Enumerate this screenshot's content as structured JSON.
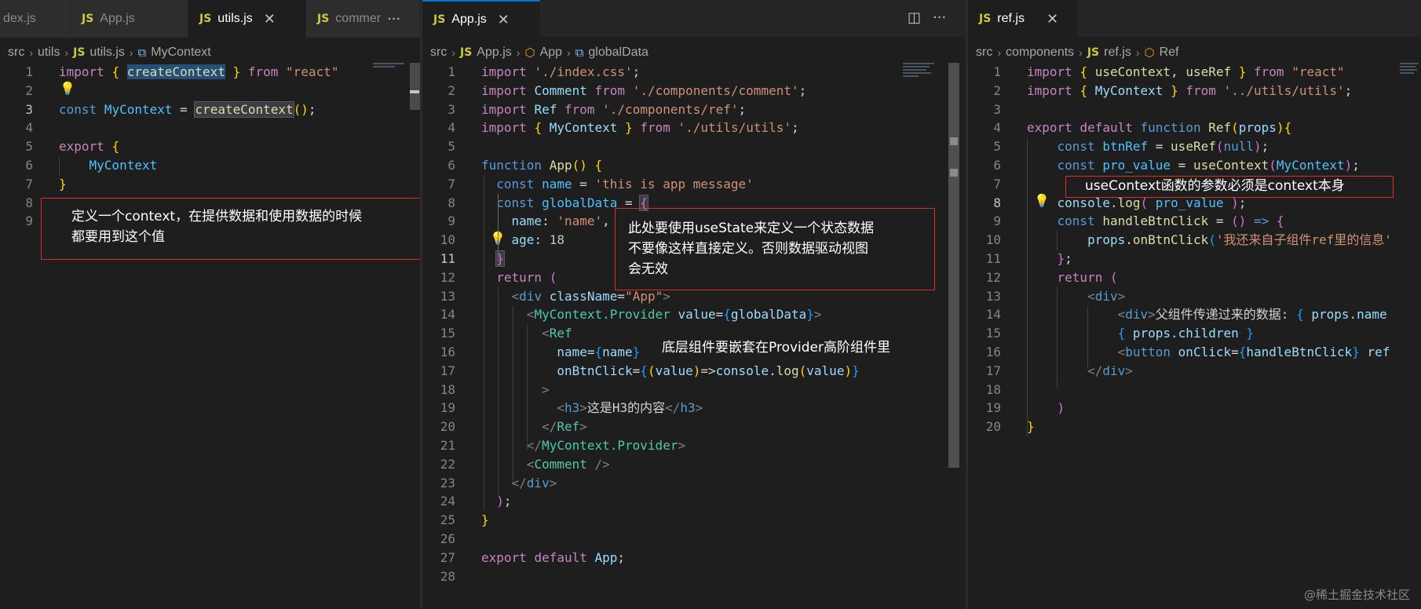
{
  "panes": [
    {
      "tabs": [
        {
          "label": "dex.js",
          "icon": "",
          "state": "inactive"
        },
        {
          "label": "App.js",
          "icon": "JS",
          "state": "inactive"
        },
        {
          "label": "utils.js",
          "icon": "JS",
          "state": "active"
        },
        {
          "label": "commer",
          "icon": "JS",
          "state": "inactive"
        }
      ],
      "breadcrumb": [
        "src",
        "utils",
        "utils.js",
        "MyContext"
      ],
      "current_line": 3,
      "line_numbers": [
        "1",
        "2",
        "3",
        "4",
        "5",
        "6",
        "7",
        "8",
        "9"
      ]
    },
    {
      "tabs": [
        {
          "label": "App.js",
          "icon": "JS",
          "state": "active"
        }
      ],
      "breadcrumb": [
        "src",
        "App.js",
        "App",
        "globalData"
      ],
      "current_line": 11,
      "line_numbers": [
        "1",
        "2",
        "3",
        "4",
        "5",
        "6",
        "7",
        "8",
        "9",
        "10",
        "11",
        "12",
        "13",
        "14",
        "15",
        "16",
        "17",
        "18",
        "19",
        "20",
        "21",
        "22",
        "23",
        "24",
        "25",
        "26",
        "27",
        "28"
      ]
    },
    {
      "tabs": [
        {
          "label": "ref.js",
          "icon": "JS",
          "state": "active"
        }
      ],
      "breadcrumb": [
        "src",
        "components",
        "ref.js",
        "Ref"
      ],
      "current_line": 8,
      "line_numbers": [
        "1",
        "2",
        "3",
        "4",
        "5",
        "6",
        "7",
        "8",
        "9",
        "10",
        "11",
        "12",
        "13",
        "14",
        "15",
        "16",
        "17",
        "18",
        "19",
        "20"
      ]
    }
  ],
  "code": {
    "utils": [
      [
        [
          "kw2",
          "import"
        ],
        [
          "txt",
          " "
        ],
        [
          "br1",
          "{"
        ],
        [
          "txt",
          " "
        ],
        [
          "fn hl",
          "createContext"
        ],
        [
          "txt",
          " "
        ],
        [
          "br1",
          "}"
        ],
        [
          "txt",
          " "
        ],
        [
          "kw2",
          "from"
        ],
        [
          "txt",
          " "
        ],
        [
          "str",
          "\"react\""
        ]
      ],
      [],
      [
        [
          "kw",
          "const"
        ],
        [
          "txt",
          " "
        ],
        [
          "const",
          "MyContext"
        ],
        [
          "txt",
          " = "
        ],
        [
          "fn hl2",
          "createContext"
        ],
        [
          "br1",
          "()"
        ],
        [
          "txt",
          ";"
        ]
      ],
      [],
      [
        [
          "kw2",
          "export"
        ],
        [
          "txt",
          " "
        ],
        [
          "br1",
          "{"
        ]
      ],
      [
        [
          "txt",
          "    "
        ],
        [
          "const",
          "MyContext"
        ]
      ],
      [
        [
          "br1",
          "}"
        ]
      ],
      [],
      []
    ],
    "app": [
      [
        [
          "kw2",
          "import"
        ],
        [
          "txt",
          " "
        ],
        [
          "str",
          "'./index.css'"
        ],
        [
          "txt",
          ";"
        ]
      ],
      [
        [
          "kw2",
          "import"
        ],
        [
          "txt",
          " "
        ],
        [
          "var",
          "Comment"
        ],
        [
          "txt",
          " "
        ],
        [
          "kw2",
          "from"
        ],
        [
          "txt",
          " "
        ],
        [
          "str",
          "'./components/comment'"
        ],
        [
          "txt",
          ";"
        ]
      ],
      [
        [
          "kw2",
          "import"
        ],
        [
          "txt",
          " "
        ],
        [
          "var",
          "Ref"
        ],
        [
          "txt",
          " "
        ],
        [
          "kw2",
          "from"
        ],
        [
          "txt",
          " "
        ],
        [
          "str",
          "'./components/ref'"
        ],
        [
          "txt",
          ";"
        ]
      ],
      [
        [
          "kw2",
          "import"
        ],
        [
          "txt",
          " "
        ],
        [
          "br1",
          "{"
        ],
        [
          "txt",
          " "
        ],
        [
          "var",
          "MyContext"
        ],
        [
          "txt",
          " "
        ],
        [
          "br1",
          "}"
        ],
        [
          "txt",
          " "
        ],
        [
          "kw2",
          "from"
        ],
        [
          "txt",
          " "
        ],
        [
          "str",
          "'./utils/utils'"
        ],
        [
          "txt",
          ";"
        ]
      ],
      [],
      [
        [
          "kw",
          "function"
        ],
        [
          "txt",
          " "
        ],
        [
          "fn",
          "App"
        ],
        [
          "br1",
          "()"
        ],
        [
          "txt",
          " "
        ],
        [
          "br1",
          "{"
        ]
      ],
      [
        [
          "txt",
          "  "
        ],
        [
          "kw",
          "const"
        ],
        [
          "txt",
          " "
        ],
        [
          "const",
          "name"
        ],
        [
          "txt",
          " = "
        ],
        [
          "str",
          "'this is app message'"
        ]
      ],
      [
        [
          "txt",
          "  "
        ],
        [
          "kw",
          "const"
        ],
        [
          "txt",
          " "
        ],
        [
          "const",
          "globalData"
        ],
        [
          "txt",
          " = "
        ],
        [
          "br2 hl2",
          "{"
        ]
      ],
      [
        [
          "txt",
          "    "
        ],
        [
          "var",
          "name"
        ],
        [
          "txt",
          ": "
        ],
        [
          "str",
          "'name'"
        ],
        [
          "txt",
          ","
        ]
      ],
      [
        [
          "txt",
          "    "
        ],
        [
          "var",
          "age"
        ],
        [
          "txt",
          ": "
        ],
        [
          "num",
          "18"
        ]
      ],
      [
        [
          "txt",
          "  "
        ],
        [
          "br2 hl2",
          "}"
        ]
      ],
      [
        [
          "txt",
          "  "
        ],
        [
          "kw2",
          "return"
        ],
        [
          "txt",
          " "
        ],
        [
          "br2",
          "("
        ]
      ],
      [
        [
          "txt",
          "    "
        ],
        [
          "punc",
          "<"
        ],
        [
          "tag",
          "div"
        ],
        [
          "txt",
          " "
        ],
        [
          "var",
          "className"
        ],
        [
          "txt",
          "="
        ],
        [
          "str",
          "\"App\""
        ],
        [
          "punc",
          ">"
        ]
      ],
      [
        [
          "txt",
          "      "
        ],
        [
          "punc",
          "<"
        ],
        [
          "cls",
          "MyContext.Provider"
        ],
        [
          "txt",
          " "
        ],
        [
          "var",
          "value"
        ],
        [
          "txt",
          "="
        ],
        [
          "br3",
          "{"
        ],
        [
          "var",
          "globalData"
        ],
        [
          "br3",
          "}"
        ],
        [
          "punc",
          ">"
        ]
      ],
      [
        [
          "txt",
          "        "
        ],
        [
          "punc",
          "<"
        ],
        [
          "cls",
          "Ref"
        ]
      ],
      [
        [
          "txt",
          "          "
        ],
        [
          "var",
          "name"
        ],
        [
          "txt",
          "="
        ],
        [
          "br3",
          "{"
        ],
        [
          "var",
          "name"
        ],
        [
          "br3",
          "}"
        ]
      ],
      [
        [
          "txt",
          "          "
        ],
        [
          "var",
          "onBtnClick"
        ],
        [
          "txt",
          "="
        ],
        [
          "br3",
          "{"
        ],
        [
          "br1",
          "("
        ],
        [
          "var",
          "value"
        ],
        [
          "br1",
          ")"
        ],
        [
          "txt",
          "=>"
        ],
        [
          "var",
          "console"
        ],
        [
          "txt",
          "."
        ],
        [
          "fn",
          "log"
        ],
        [
          "br1",
          "("
        ],
        [
          "var",
          "value"
        ],
        [
          "br1",
          ")"
        ],
        [
          "br3",
          "}"
        ]
      ],
      [
        [
          "txt",
          "        "
        ],
        [
          "punc",
          ">"
        ]
      ],
      [
        [
          "txt",
          "          "
        ],
        [
          "punc",
          "<"
        ],
        [
          "tag",
          "h3"
        ],
        [
          "punc",
          ">"
        ],
        [
          "txt",
          "这是H3的内容"
        ],
        [
          "punc",
          "</"
        ],
        [
          "tag",
          "h3"
        ],
        [
          "punc",
          ">"
        ]
      ],
      [
        [
          "txt",
          "        "
        ],
        [
          "punc",
          "</"
        ],
        [
          "cls",
          "Ref"
        ],
        [
          "punc",
          ">"
        ]
      ],
      [
        [
          "txt",
          "      "
        ],
        [
          "punc",
          "</"
        ],
        [
          "cls",
          "MyContext.Provider"
        ],
        [
          "punc",
          ">"
        ]
      ],
      [
        [
          "txt",
          "      "
        ],
        [
          "punc",
          "<"
        ],
        [
          "cls",
          "Comment"
        ],
        [
          "txt",
          " "
        ],
        [
          "punc",
          "/>"
        ]
      ],
      [
        [
          "txt",
          "    "
        ],
        [
          "punc",
          "</"
        ],
        [
          "tag",
          "div"
        ],
        [
          "punc",
          ">"
        ]
      ],
      [
        [
          "txt",
          "  "
        ],
        [
          "br2",
          ")"
        ],
        [
          "txt",
          ";"
        ]
      ],
      [
        [
          "br1",
          "}"
        ]
      ],
      [],
      [
        [
          "kw2",
          "export"
        ],
        [
          "txt",
          " "
        ],
        [
          "kw2",
          "default"
        ],
        [
          "txt",
          " "
        ],
        [
          "var",
          "App"
        ],
        [
          "txt",
          ";"
        ]
      ],
      []
    ],
    "ref": [
      [
        [
          "kw2",
          "import"
        ],
        [
          "txt",
          " "
        ],
        [
          "br1",
          "{"
        ],
        [
          "txt",
          " "
        ],
        [
          "fn",
          "useContext"
        ],
        [
          "txt",
          ", "
        ],
        [
          "fn",
          "useRef"
        ],
        [
          "txt",
          " "
        ],
        [
          "br1",
          "}"
        ],
        [
          "txt",
          " "
        ],
        [
          "kw2",
          "from"
        ],
        [
          "txt",
          " "
        ],
        [
          "str",
          "\"react\""
        ]
      ],
      [
        [
          "kw2",
          "import"
        ],
        [
          "txt",
          " "
        ],
        [
          "br1",
          "{"
        ],
        [
          "txt",
          " "
        ],
        [
          "var",
          "MyContext"
        ],
        [
          "txt",
          " "
        ],
        [
          "br1",
          "}"
        ],
        [
          "txt",
          " "
        ],
        [
          "kw2",
          "from"
        ],
        [
          "txt",
          " "
        ],
        [
          "str",
          "'../utils/utils'"
        ],
        [
          "txt",
          ";"
        ]
      ],
      [],
      [
        [
          "kw2",
          "export"
        ],
        [
          "txt",
          " "
        ],
        [
          "kw2",
          "default"
        ],
        [
          "txt",
          " "
        ],
        [
          "kw",
          "function"
        ],
        [
          "txt",
          " "
        ],
        [
          "fn",
          "Ref"
        ],
        [
          "br1",
          "("
        ],
        [
          "var",
          "props"
        ],
        [
          "br1",
          ")"
        ],
        [
          "br1",
          "{"
        ]
      ],
      [
        [
          "txt",
          "    "
        ],
        [
          "kw",
          "const"
        ],
        [
          "txt",
          " "
        ],
        [
          "const",
          "btnRef"
        ],
        [
          "txt",
          " = "
        ],
        [
          "fn",
          "useRef"
        ],
        [
          "br2",
          "("
        ],
        [
          "kw",
          "null"
        ],
        [
          "br2",
          ")"
        ],
        [
          "txt",
          ";"
        ]
      ],
      [
        [
          "txt",
          "    "
        ],
        [
          "kw",
          "const"
        ],
        [
          "txt",
          " "
        ],
        [
          "const",
          "pro_value"
        ],
        [
          "txt",
          " = "
        ],
        [
          "fn",
          "useContext"
        ],
        [
          "br2",
          "("
        ],
        [
          "const",
          "MyContext"
        ],
        [
          "br2",
          ")"
        ],
        [
          "txt",
          ";"
        ]
      ],
      [],
      [
        [
          "txt",
          "    "
        ],
        [
          "var",
          "console"
        ],
        [
          "txt",
          "."
        ],
        [
          "fn",
          "log"
        ],
        [
          "br2",
          "("
        ],
        [
          "txt",
          " "
        ],
        [
          "const",
          "pro_value"
        ],
        [
          "txt",
          " "
        ],
        [
          "br2",
          ")"
        ],
        [
          "txt",
          ";"
        ]
      ],
      [
        [
          "txt",
          "    "
        ],
        [
          "kw",
          "const"
        ],
        [
          "txt",
          " "
        ],
        [
          "fn",
          "handleBtnClick"
        ],
        [
          "txt",
          " = "
        ],
        [
          "br2",
          "()"
        ],
        [
          "txt",
          " "
        ],
        [
          "kw",
          "=>"
        ],
        [
          "txt",
          " "
        ],
        [
          "br2",
          "{"
        ]
      ],
      [
        [
          "txt",
          "        "
        ],
        [
          "var",
          "props"
        ],
        [
          "txt",
          "."
        ],
        [
          "fn",
          "onBtnClick"
        ],
        [
          "br3",
          "("
        ],
        [
          "str",
          "'我还来自子组件ref里的信息'"
        ]
      ],
      [
        [
          "txt",
          "    "
        ],
        [
          "br2",
          "}"
        ],
        [
          "txt",
          ";"
        ]
      ],
      [
        [
          "txt",
          "    "
        ],
        [
          "kw2",
          "return"
        ],
        [
          "txt",
          " "
        ],
        [
          "br2",
          "("
        ]
      ],
      [
        [
          "txt",
          "        "
        ],
        [
          "punc",
          "<"
        ],
        [
          "tag",
          "div"
        ],
        [
          "punc",
          ">"
        ]
      ],
      [
        [
          "txt",
          "            "
        ],
        [
          "punc",
          "<"
        ],
        [
          "tag",
          "div"
        ],
        [
          "punc",
          ">"
        ],
        [
          "txt",
          "父组件传递过来的数据: "
        ],
        [
          "br3",
          "{"
        ],
        [
          "txt",
          " "
        ],
        [
          "var",
          "props.name"
        ]
      ],
      [
        [
          "txt",
          "            "
        ],
        [
          "br3",
          "{"
        ],
        [
          "txt",
          " "
        ],
        [
          "var",
          "props.children"
        ],
        [
          "txt",
          " "
        ],
        [
          "br3",
          "}"
        ]
      ],
      [
        [
          "txt",
          "            "
        ],
        [
          "punc",
          "<"
        ],
        [
          "tag",
          "button"
        ],
        [
          "txt",
          " "
        ],
        [
          "var",
          "onClick"
        ],
        [
          "txt",
          "="
        ],
        [
          "br3",
          "{"
        ],
        [
          "var",
          "handleBtnClick"
        ],
        [
          "br3",
          "}"
        ],
        [
          "txt",
          " "
        ],
        [
          "var",
          "ref"
        ]
      ],
      [
        [
          "txt",
          "        "
        ],
        [
          "punc",
          "</"
        ],
        [
          "tag",
          "div"
        ],
        [
          "punc",
          ">"
        ]
      ],
      [],
      [
        [
          "txt",
          "    "
        ],
        [
          "br2",
          ")"
        ]
      ],
      [
        [
          "br1",
          "}"
        ]
      ]
    ]
  },
  "annotations": {
    "utils_note": "定义一个context，在提供数据和使用数据的时候\n都要用到这个值",
    "usestate_note": "此处要使用useState来定义一个状态数据\n不要像这样直接定义。否则数据驱动视图\n会无效",
    "provider_note": "底层组件要嵌套在Provider高阶组件里",
    "usecontext_note": "useContext函数的参数必须是context本身"
  },
  "icons": {
    "tab_file": "js-file-icon",
    "close": "close-icon",
    "more": "more-actions-icon",
    "split": "split-editor-icon",
    "symbol_variable": "variable-symbol-icon",
    "symbol_class": "class-symbol-icon",
    "lightbulb": "lightbulb-icon",
    "chevron": "chevron-right-icon"
  },
  "watermark": "@稀土掘金技术社区",
  "colors": {
    "editor_bg": "#1e1e1e",
    "tab_bar_bg": "#252526",
    "active_tab_accent": "#0078d4",
    "annotation_border": "#d9302c",
    "js_badge": "#cbcb41"
  }
}
